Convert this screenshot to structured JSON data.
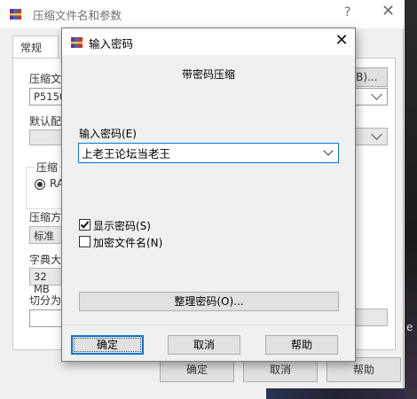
{
  "background_window": {
    "title": "压缩文件名和参数",
    "help_glyph": "?",
    "close_glyph": "✕",
    "tab_general": "常规",
    "archive_name_label": "压缩文",
    "archive_name_value": "P5150(",
    "browse_button": "(B)...",
    "default_profile_label": "默认配",
    "format_group_label": "压缩",
    "format_radio_label": "RA",
    "method_label": "压缩方",
    "method_value": "标准",
    "dictionary_label": "字典大",
    "dictionary_value": "32 MB",
    "split_label": "切分为",
    "ok_button": "确定",
    "cancel_button": "取消",
    "help_button": "帮助",
    "edge_char": "e"
  },
  "dialog": {
    "title": "输入密码",
    "header": "带密码压缩",
    "password_label": "输入密码(E)",
    "password_value": "上老王论坛当老王",
    "show_password": {
      "label": "显示密码(S)",
      "checked": true
    },
    "encrypt_filenames": {
      "label": "加密文件名(N)",
      "checked": false
    },
    "organize_button": "整理密码(O)...",
    "ok_button": "确定",
    "cancel_button": "取消",
    "help_button": "帮助",
    "close_glyph": "✕"
  },
  "colors": {
    "accent": "#0078d7",
    "window_bg": "#f0f0f0",
    "button_bg": "#e1e1e1"
  },
  "icons": [
    "winrar-books-icon",
    "close-icon",
    "help-icon",
    "chevron-down-icon",
    "checkmark-icon"
  ]
}
